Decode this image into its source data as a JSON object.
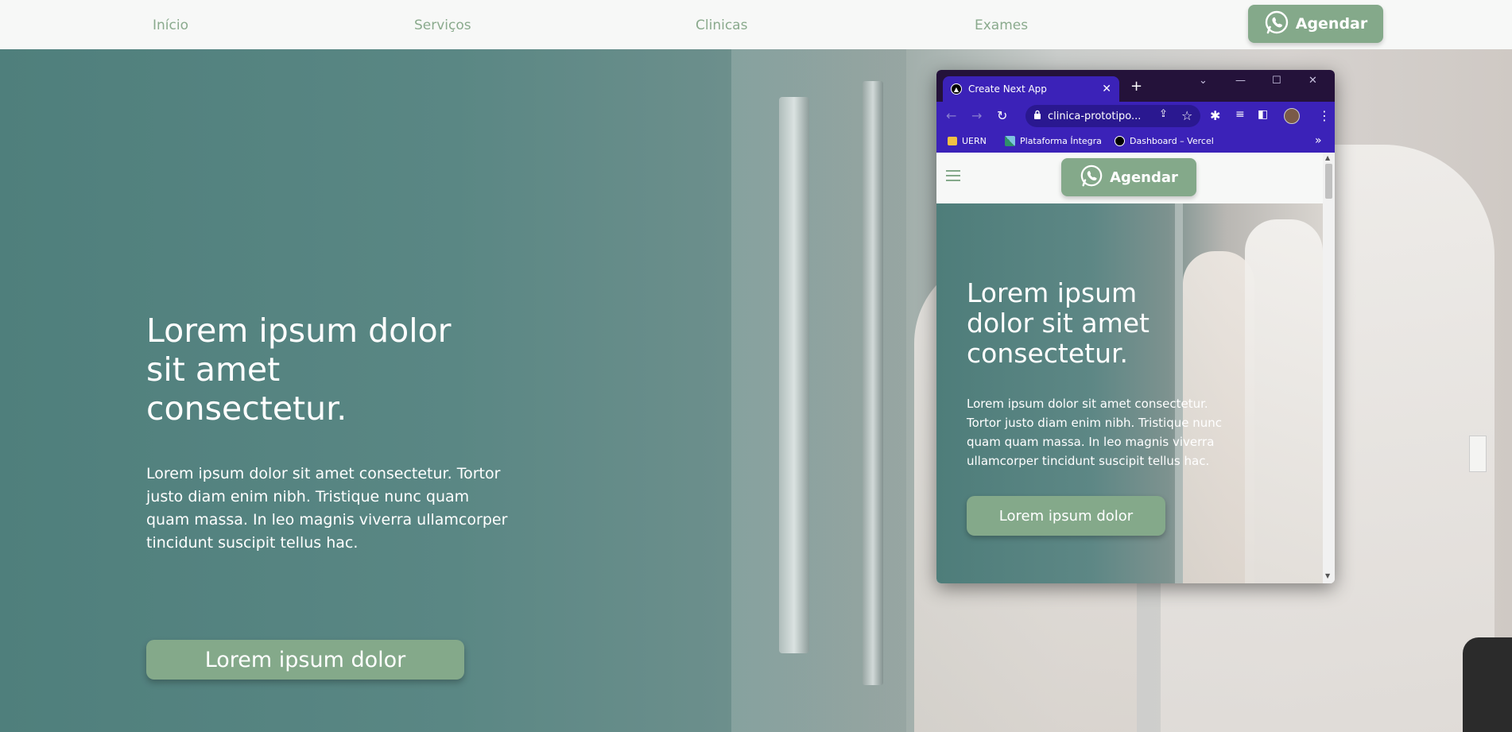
{
  "nav": {
    "links": [
      "Início",
      "Serviços",
      "Clinicas",
      "Exames"
    ],
    "cta_label": "Agendar",
    "cta_icon": "whatsapp-icon"
  },
  "hero": {
    "title": "Lorem ipsum dolor sit amet consectetur.",
    "text": "Lorem ipsum dolor sit amet consectetur. Tortor justo diam enim nibh. Tristique nunc quam quam massa. In leo magnis viverra ullamcorper tincidunt suscipit tellus hac.",
    "button_label": "Lorem ipsum dolor"
  },
  "browser": {
    "tab_title": "Create Next App",
    "tab_close": "✕",
    "new_tab": "+",
    "controls": [
      "⌄",
      "—",
      "☐",
      "✕"
    ],
    "url": "clinica-prototipo...",
    "bookmarks": [
      "UERN",
      "Plataforma Íntegra",
      "Dashboard – Vercel"
    ],
    "bookmarks_more": "»"
  },
  "mobile": {
    "cta_label": "Agendar",
    "title": "Lorem ipsum dolor sit amet consectetur.",
    "text": "Lorem ipsum dolor sit amet consectetur. Tortor justo diam enim nibh. Tristique nunc quam quam massa. In leo magnis viverra ullamcorper tincidunt suscipit tellus hac.",
    "button_label": "Lorem ipsum dolor"
  },
  "colors": {
    "accent": "#84a98a",
    "teal": "#4f7f7c",
    "browser_purple": "#3b22b8",
    "browser_dark": "#24123a"
  }
}
